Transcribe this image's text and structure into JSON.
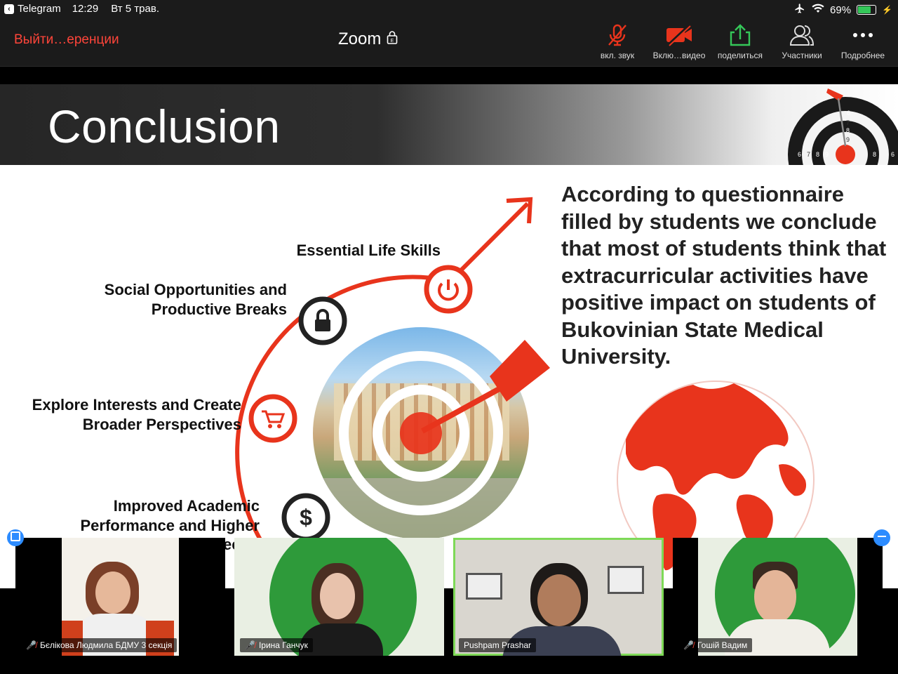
{
  "status_bar": {
    "back_app": "Telegram",
    "time": "12:29",
    "date": "Вт 5 трав.",
    "battery": "69%",
    "battery_level": 0.69
  },
  "toolbar": {
    "leave_label": "Выйти…еренции",
    "title": "Zoom",
    "buttons": [
      {
        "label": "вкл. звук",
        "icon": "muted-mic-icon"
      },
      {
        "label": "Вклю…видео",
        "icon": "video-off-icon"
      },
      {
        "label": "поделиться",
        "icon": "share-screen-icon"
      },
      {
        "label": "Участники",
        "icon": "participants-icon"
      },
      {
        "label": "Подробнее",
        "icon": "more-icon"
      }
    ]
  },
  "slide": {
    "title": "Conclusion",
    "items": [
      {
        "line1": "Essential Life Skills",
        "line2": "",
        "icon": "power-icon"
      },
      {
        "line1": "Social Opportunities and",
        "line2": "Productive Breaks",
        "icon": "lock-icon"
      },
      {
        "line1": "Explore Interests and Create",
        "line2": "Broader Perspectives",
        "icon": "cart-icon"
      },
      {
        "line1": "Improved Academic",
        "line2": "Performance and Higher",
        "icon": "dollar-icon"
      }
    ],
    "conclusion_text": "According to questionnaire filled by students we conclude that most of students think that extracurricular activities have positive impact on students of Bukovinian State Medical University.",
    "target_numbers": [
      "6",
      "7",
      "8",
      "9",
      "9",
      "8",
      "7",
      "6",
      "8",
      "6"
    ]
  },
  "participants": [
    {
      "name": "Бєлікова Людмила БДМУ 3 секція",
      "muted": true,
      "active": false
    },
    {
      "name": "Ірина Ганчук",
      "muted": true,
      "active": false
    },
    {
      "name": "Pushpam Prashar",
      "muted": false,
      "active": true
    },
    {
      "name": "Гошій Вадим",
      "muted": true,
      "active": false
    }
  ],
  "colors": {
    "accent_red": "#e8341c",
    "leave_red": "#ff453a",
    "share_green": "#35c759",
    "active_speaker": "#7ed957"
  }
}
